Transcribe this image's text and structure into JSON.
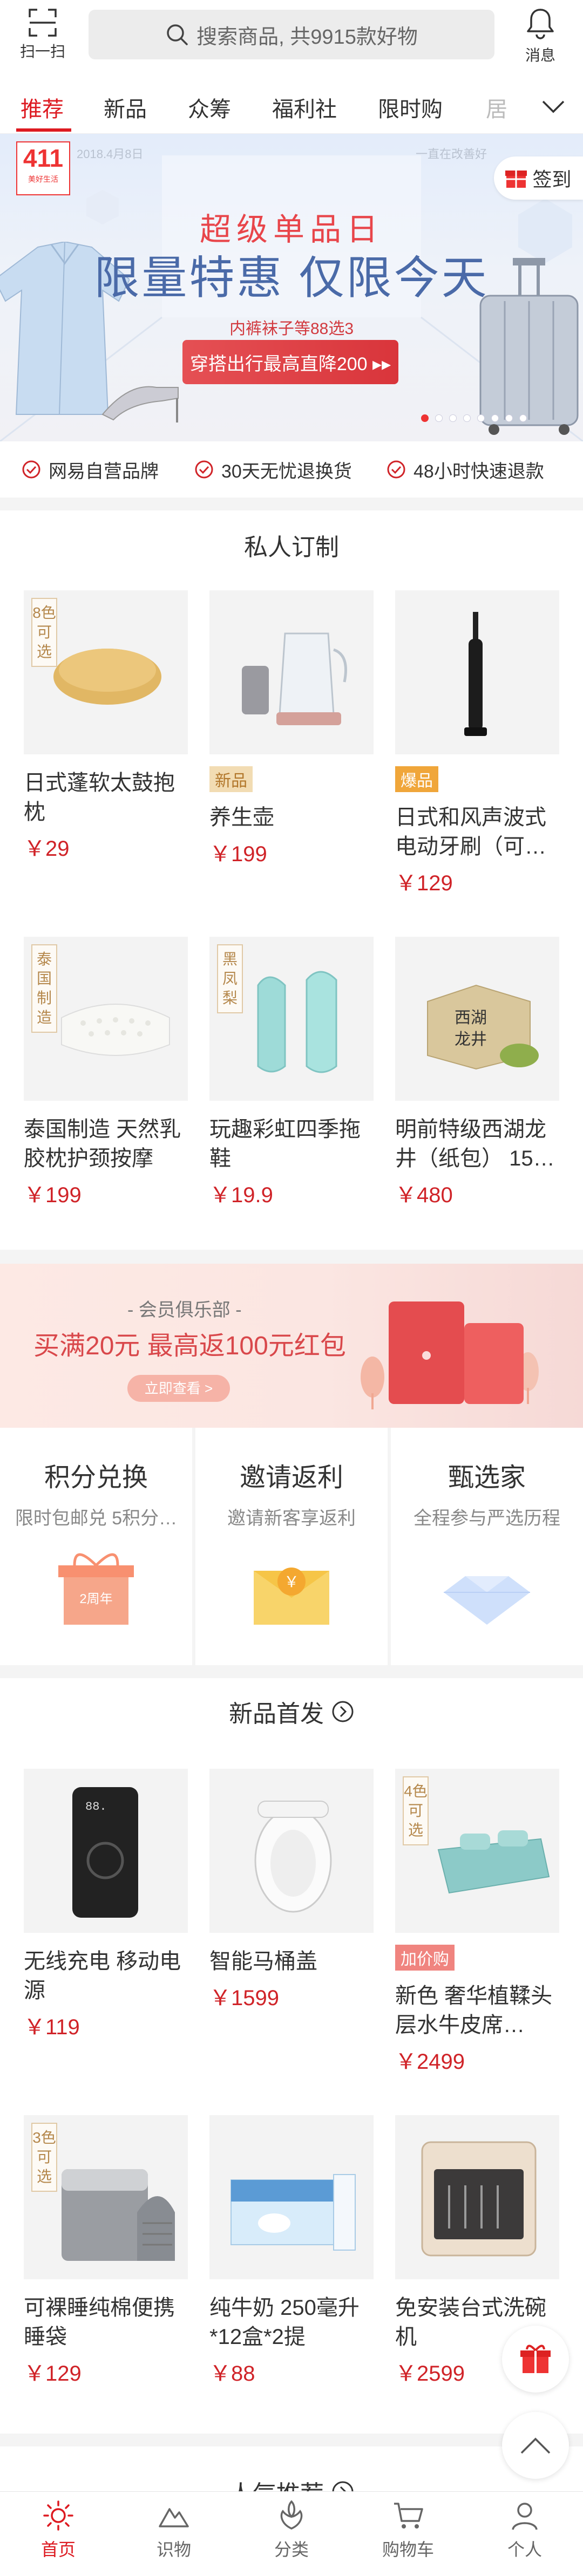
{
  "header": {
    "scan_label": "扫一扫",
    "search_placeholder": "搜索商品, 共9915款好物",
    "message_label": "消息"
  },
  "tabs": [
    "推荐",
    "新品",
    "众筹",
    "福利社",
    "限时购",
    "居"
  ],
  "banner": {
    "logo_big": "411",
    "logo_small": "美好生活",
    "date_left": "2018.4月8日",
    "date_right": "一直在改善好",
    "signin_label": "签到",
    "subtitle": "超级单品日",
    "title": "限量特惠 仅限今天",
    "note": "内裤袜子等88选3",
    "cta": "穿搭出行最高直降200 ▸▸",
    "slide_count": 8,
    "active_slide": 1
  },
  "guarantees": [
    "网易自营品牌",
    "30天无忧退换货",
    "48小时快速退款"
  ],
  "custom": {
    "title": "私人订制",
    "items": [
      {
        "name": "日式蓬软太鼓抱枕",
        "price": "￥29",
        "tag": "",
        "vtag": "8色可选"
      },
      {
        "name": "养生壶",
        "price": "￥199",
        "tag": "新品",
        "vtag": ""
      },
      {
        "name": "日式和风声波式电动牙刷（可…",
        "price": "￥129",
        "tag": "爆品",
        "vtag": ""
      },
      {
        "name": "泰国制造 天然乳胶枕护颈按摩",
        "price": "￥199",
        "tag": "",
        "vtag": "泰国制造"
      },
      {
        "name": "玩趣彩虹四季拖鞋",
        "price": "￥19.9",
        "tag": "",
        "vtag": "黑凤梨"
      },
      {
        "name": "明前特级西湖龙井（纸包） 15…",
        "price": "￥480",
        "tag": "",
        "vtag": ""
      }
    ]
  },
  "club": {
    "subtitle": "- 会员俱乐部 -",
    "title": "买满20元 最高返100元红包",
    "button": "立即查看 >"
  },
  "tiles": [
    {
      "title": "积分兑换",
      "sub": "限时包邮兑 5积分…",
      "gift_label": "2周年"
    },
    {
      "title": "邀请返利",
      "sub": "邀请新客享返利",
      "gift_label": "￥"
    },
    {
      "title": "甄选家",
      "sub": "全程参与严选历程",
      "gift_label": ""
    }
  ],
  "newarrivals": {
    "title": "新品首发",
    "items": [
      {
        "name": "无线充电 移动电源",
        "price": "￥119",
        "tag": "",
        "vtag": "",
        "screen": "88."
      },
      {
        "name": "智能马桶盖",
        "price": "￥1599",
        "tag": "",
        "vtag": ""
      },
      {
        "name": "新色 奢华植鞣头层水牛皮席…",
        "price": "￥2499",
        "tag": "加价购",
        "vtag": "4色可选"
      },
      {
        "name": "可裸睡纯棉便携睡袋",
        "price": "￥129",
        "tag": "",
        "vtag": "3色可选"
      },
      {
        "name": "纯牛奶 250毫升*12盒*2提",
        "price": "￥88",
        "tag": "",
        "vtag": ""
      },
      {
        "name": "免安装台式洗碗机",
        "price": "￥2599",
        "tag": "",
        "vtag": ""
      }
    ]
  },
  "popular_title": "人气推荐",
  "bottom_nav": [
    "首页",
    "识物",
    "分类",
    "购物车",
    "个人"
  ],
  "colors": {
    "brand_red": "#dd1a21",
    "price_red": "#d02328"
  },
  "icons": [
    "scan-icon",
    "search-icon",
    "bell-icon",
    "chevron-down-icon",
    "gift-icon",
    "arrow-up-icon",
    "home-icon",
    "discover-icon",
    "category-icon",
    "cart-icon",
    "user-icon"
  ]
}
